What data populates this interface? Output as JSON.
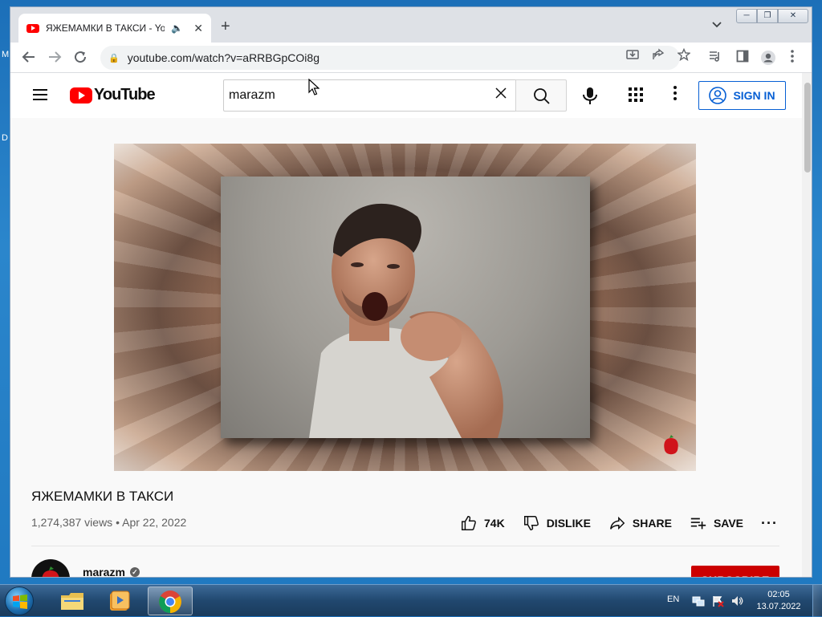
{
  "browser": {
    "tab_title": "ЯЖЕМАМКИ В ТАКСИ - YouTube",
    "url": "youtube.com/watch?v=aRRBGpCOi8g"
  },
  "youtube": {
    "search_query": "marazm",
    "sign_in_label": "SIGN IN",
    "logo_text": "YouTube"
  },
  "video": {
    "title": "ЯЖЕМАМКИ В ТАКСИ",
    "views": "1,274,387 views",
    "date": "Apr 22, 2022",
    "separator": "•",
    "likes": "74K",
    "dislike_label": "DISLIKE",
    "share_label": "SHARE",
    "save_label": "SAVE"
  },
  "channel": {
    "name": "marazm",
    "subscribe_label": "SUBSCRIBE"
  },
  "taskbar": {
    "language": "EN",
    "time": "02:05",
    "date": "13.07.2022"
  },
  "colors": {
    "youtube_red": "#ff0000",
    "subscribe_red": "#cc0000",
    "link_blue": "#065fd4",
    "taskbar_blue": "#21486f"
  },
  "icons": [
    "youtube-favicon",
    "speaker-icon",
    "close-icon",
    "plus-icon",
    "chevron-down-icon",
    "back-arrow-icon",
    "forward-arrow-icon",
    "reload-icon",
    "lock-icon",
    "install-icon",
    "share-icon",
    "star-icon",
    "reading-list-icon",
    "side-panel-icon",
    "profile-icon",
    "kebab-icon",
    "hamburger-icon",
    "search-icon",
    "mic-icon",
    "apps-grid-icon",
    "user-circle-icon",
    "thumbs-up-icon",
    "thumbs-down-icon",
    "share-arrow-icon",
    "playlist-add-icon",
    "verified-icon",
    "windows-start-icon",
    "explorer-icon",
    "media-player-icon",
    "chrome-icon",
    "network-icon",
    "flag-icon",
    "volume-icon"
  ]
}
